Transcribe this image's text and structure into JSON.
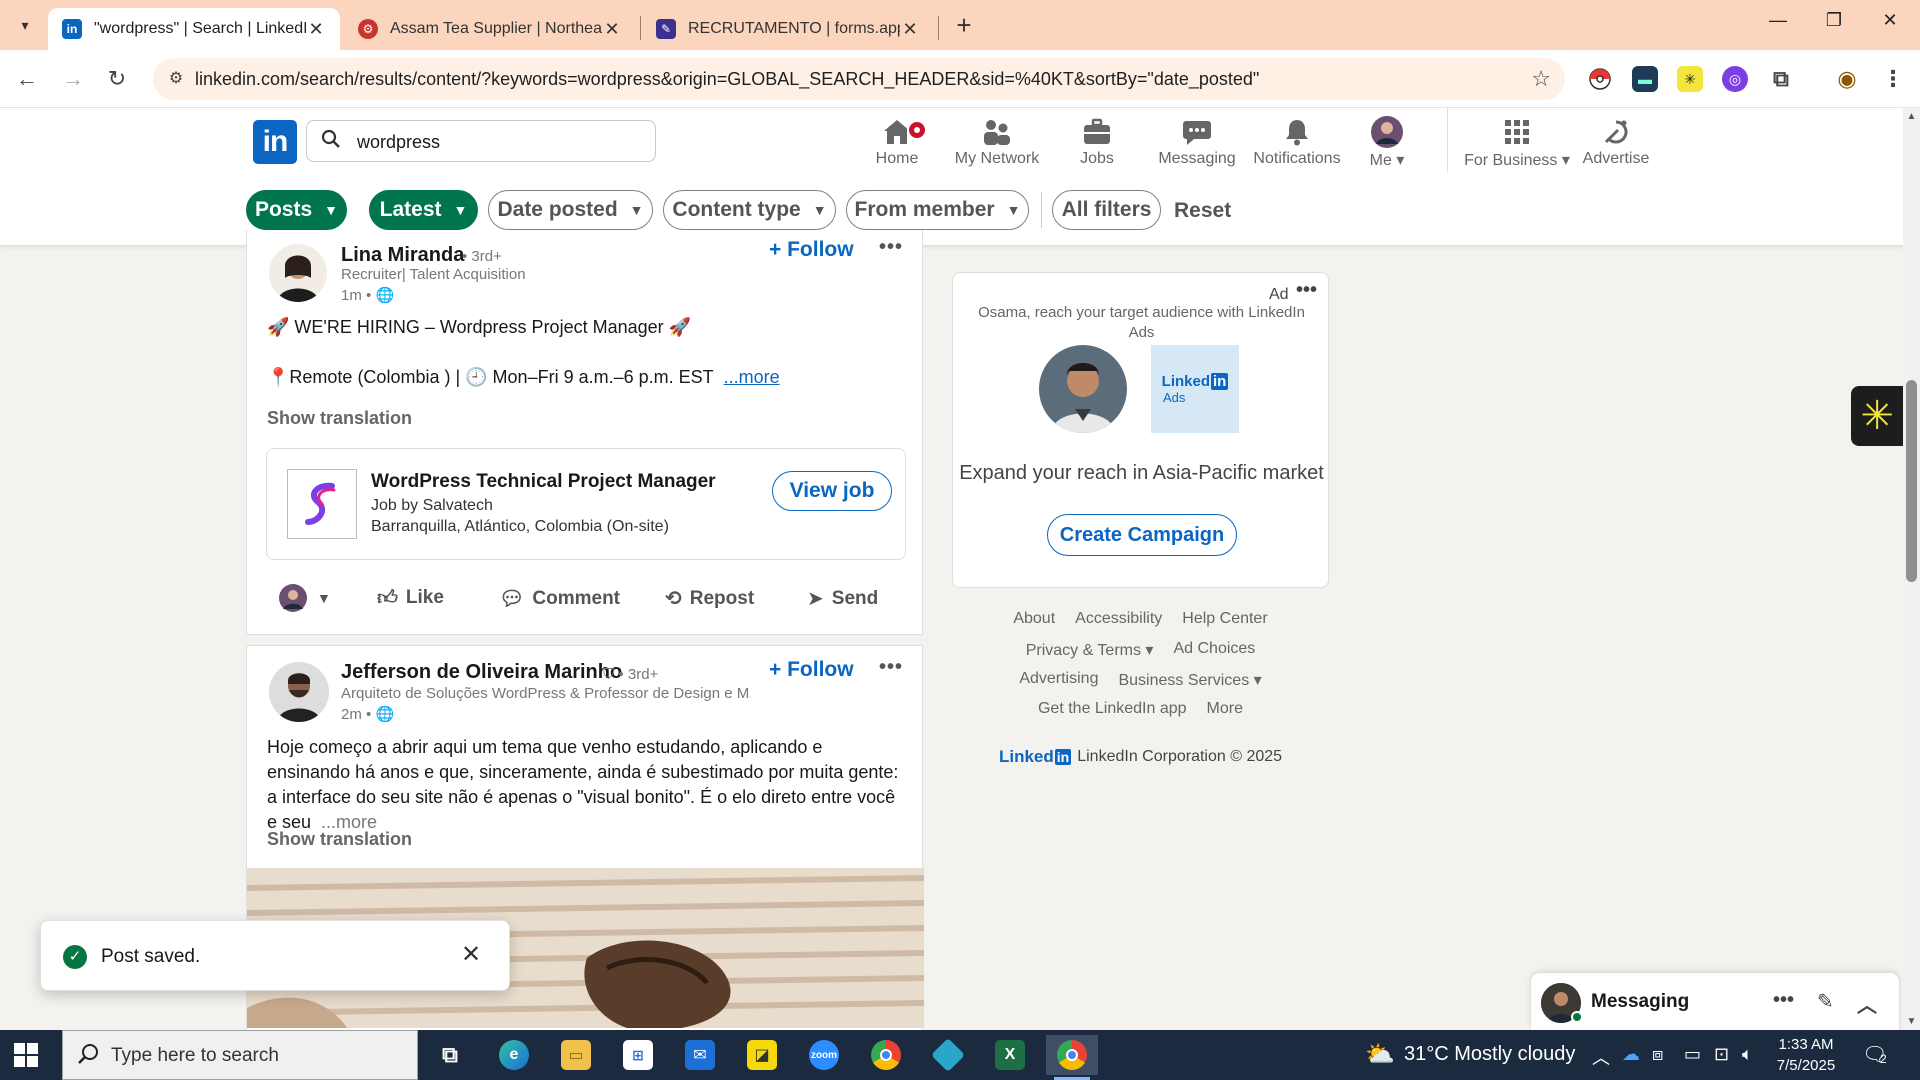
{
  "browser": {
    "tabs": [
      {
        "title": "\"wordpress\" | Search | LinkedIn",
        "active": true
      },
      {
        "title": "Assam Tea Supplier | Northeast",
        "active": false
      },
      {
        "title": "RECRUTAMENTO | forms.app",
        "active": false
      }
    ],
    "url": "linkedin.com/search/results/content/?keywords=wordpress&origin=GLOBAL_SEARCH_HEADER&sid=%40KT&sortBy=\"date_posted\""
  },
  "header": {
    "logo": "in",
    "search_value": "wordpress",
    "nav": [
      {
        "label": "Home",
        "icon": "home-icon",
        "badge": true
      },
      {
        "label": "My Network",
        "icon": "network-icon"
      },
      {
        "label": "Jobs",
        "icon": "briefcase-icon"
      },
      {
        "label": "Messaging",
        "icon": "chat-icon"
      },
      {
        "label": "Notifications",
        "icon": "bell-icon"
      },
      {
        "label": "Me",
        "icon": "avatar"
      },
      {
        "label": "For Business",
        "icon": "grid-icon"
      },
      {
        "label": "Advertise",
        "icon": "advertise-icon"
      }
    ]
  },
  "filters": {
    "pills": [
      "Posts",
      "Latest",
      "Date posted",
      "Content type",
      "From member",
      "All filters"
    ],
    "reset": "Reset"
  },
  "posts": [
    {
      "author": "Lina Miranda",
      "degree": "• 3rd+",
      "subtitle": "Recruiter| Talent Acquisition",
      "time": "1m •",
      "follow": "+ Follow",
      "line1": "🚀 WE'RE HIRING – Wordpress Project Manager 🚀",
      "line2": "📍Remote (Colombia ) | 🕘 Mon–Fri 9 a.m.–6 p.m. EST",
      "more": "...more",
      "show_translation": "Show translation",
      "job": {
        "title": "WordPress Technical Project Manager",
        "company": "Job by Salvatech",
        "location": "Barranquilla, Atlántico, Colombia (On-site)",
        "cta": "View job"
      },
      "actions": [
        "Like",
        "Comment",
        "Repost",
        "Send"
      ]
    },
    {
      "author": "Jefferson de Oliveira Marinho",
      "degree": "• 3rd+",
      "subtitle": "Arquiteto de Soluções WordPress & Professor de Design e M...",
      "time": "2m •",
      "follow": "+ Follow",
      "text": "Hoje começo a abrir aqui um tema que venho estudando, aplicando e ensinando há anos e que, sinceramente, ainda é subestimado por muita gente: a interface do seu site não é apenas o \"visual bonito\". É o elo direto entre você e seu",
      "more": "...more",
      "show_translation": "Show translation"
    }
  ],
  "ad": {
    "label": "Ad",
    "headline": "Osama, reach your target audience with LinkedIn Ads",
    "tile_text": "Linked",
    "tile_in": "in",
    "tile_sub": "Ads",
    "tagline": "Expand your reach in Asia-Pacific market",
    "cta": "Create Campaign"
  },
  "footer": {
    "rows": [
      [
        "About",
        "Accessibility",
        "Help Center"
      ],
      [
        "Privacy & Terms ▾",
        "Ad Choices"
      ],
      [
        "Advertising",
        "Business Services ▾"
      ],
      [
        "Get the LinkedIn app",
        "More"
      ]
    ],
    "logo": "Linked",
    "logo_in": "in",
    "corp": "LinkedIn Corporation © 2025"
  },
  "toast": {
    "message": "Post saved."
  },
  "messaging": {
    "title": "Messaging"
  },
  "taskbar": {
    "search_placeholder": "Type here to search",
    "weather": "31°C  Mostly cloudy",
    "time": "1:33 AM",
    "date": "7/5/2025",
    "notifications": "2"
  },
  "colors": {
    "linkedin_blue": "#0a66c2",
    "filter_green": "#01754f",
    "tabstrip": "#fbd5bd"
  }
}
